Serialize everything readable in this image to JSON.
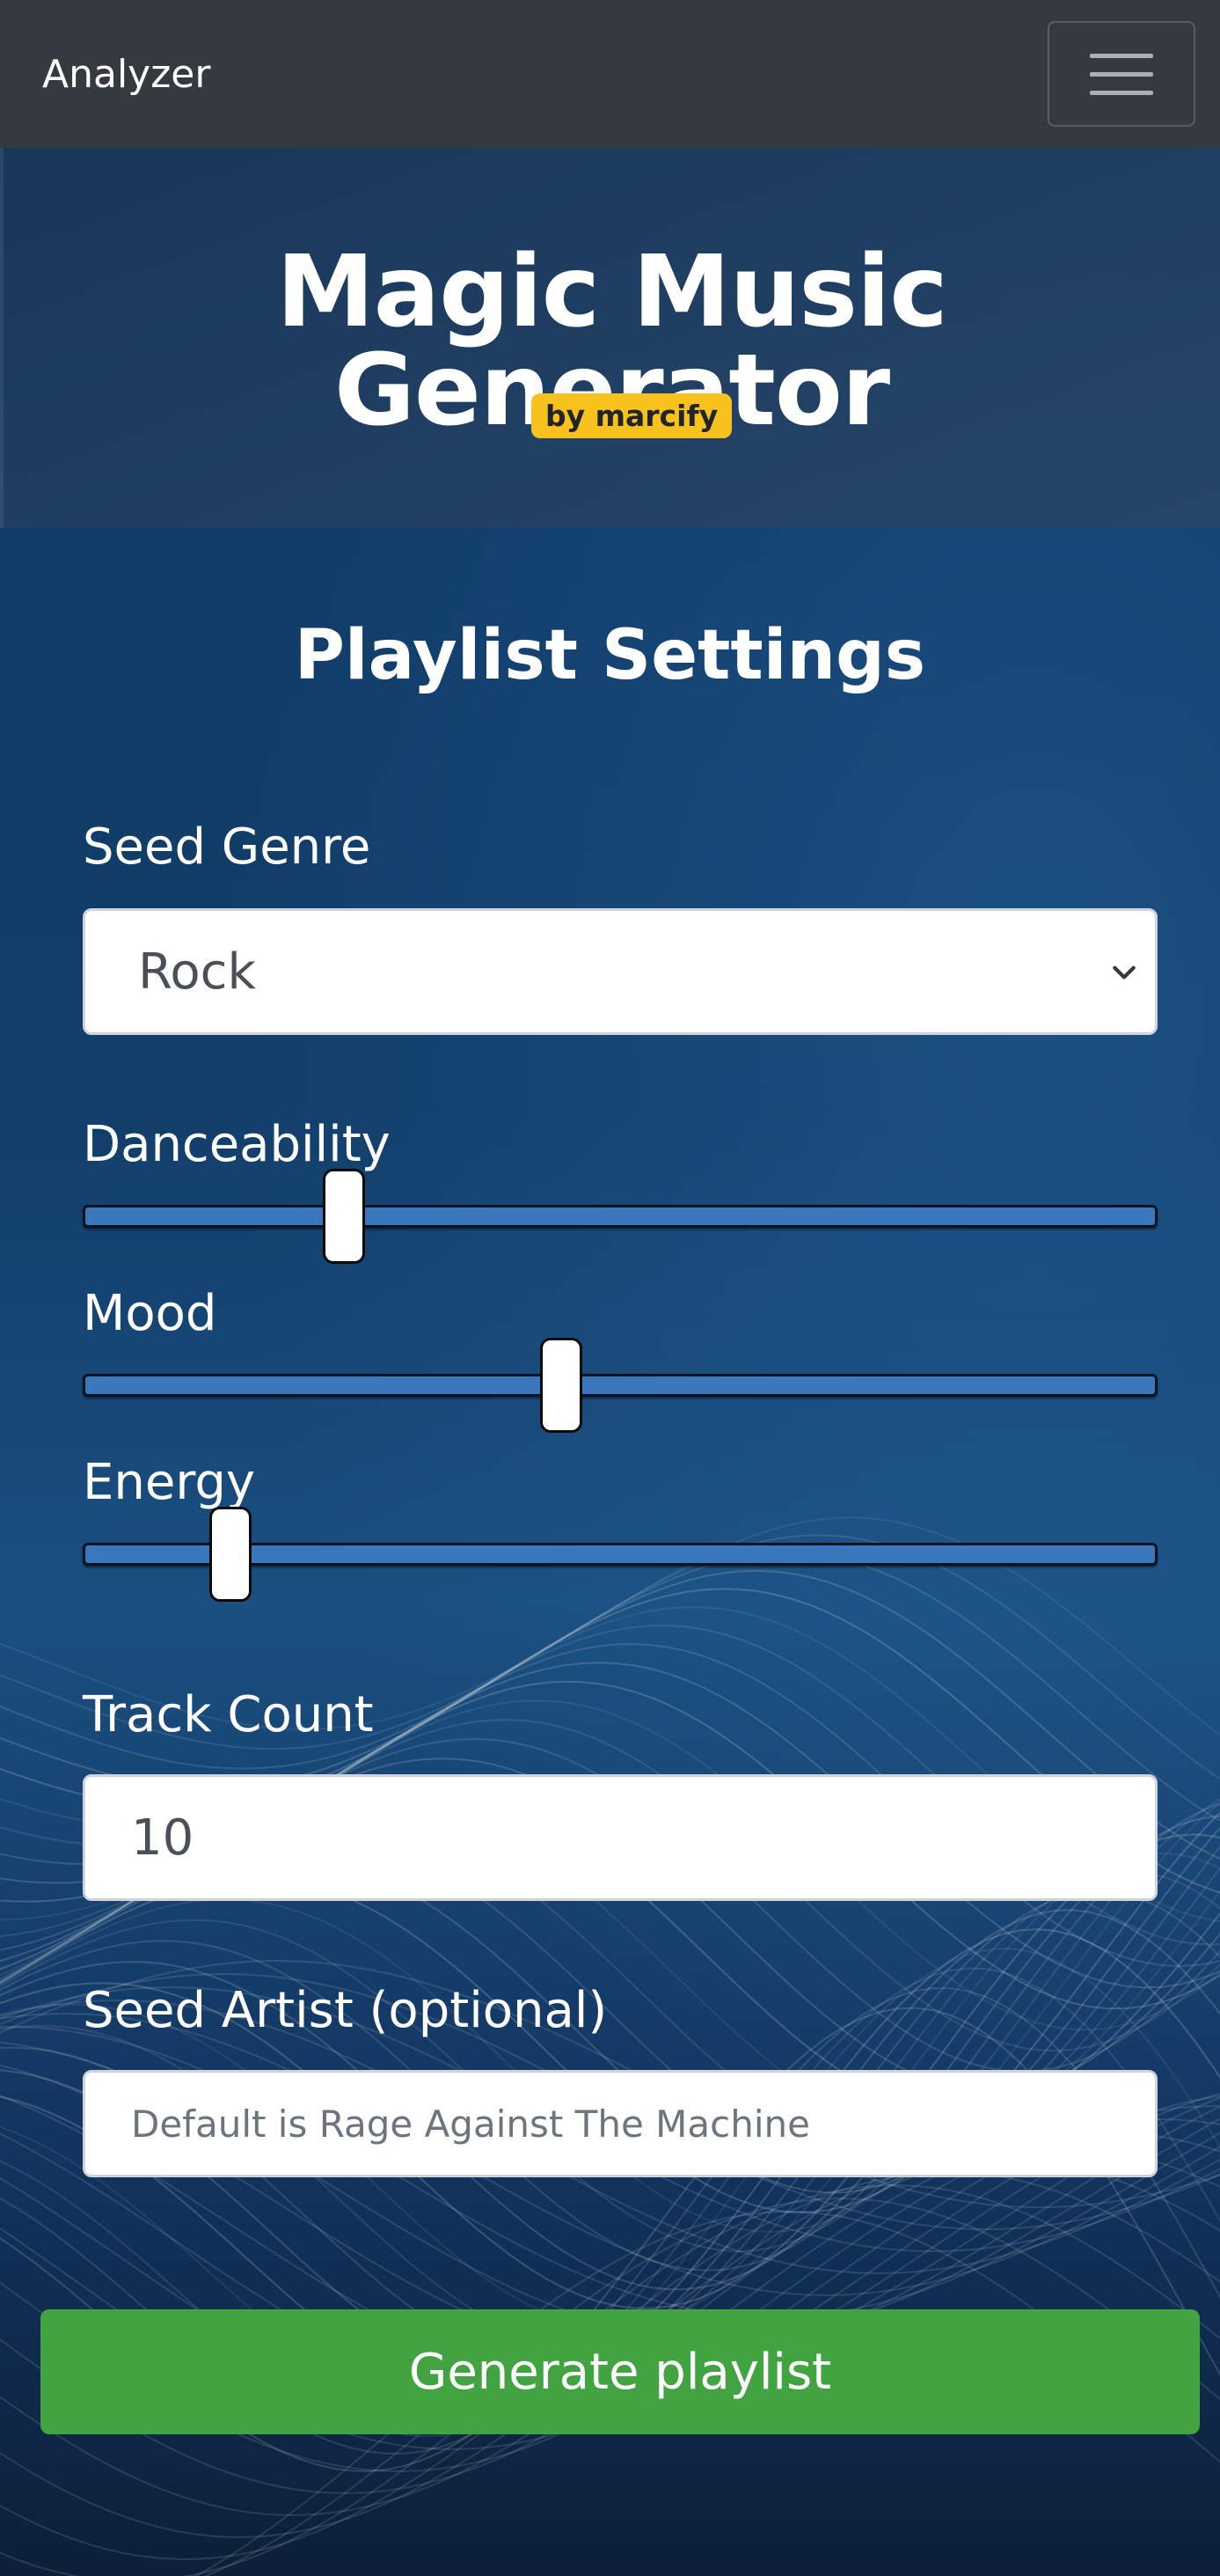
{
  "navbar": {
    "brand": "Analyzer",
    "menu_icon": "hamburger-icon"
  },
  "header": {
    "title": "Magic Music Generator",
    "badge": "by marcify",
    "badge_color": "#f7c21b"
  },
  "settings": {
    "title": "Playlist Settings",
    "seed_genre": {
      "label": "Seed Genre",
      "value": "Rock"
    },
    "danceability": {
      "label": "Danceability",
      "value_fraction": 0.23
    },
    "mood": {
      "label": "Mood",
      "value_fraction": 0.44
    },
    "energy": {
      "label": "Energy",
      "value_fraction": 0.12
    },
    "track_count": {
      "label": "Track Count",
      "value": "10"
    },
    "seed_artist": {
      "label": "Seed Artist (optional)",
      "placeholder": "Default is Rage Against The Machine"
    },
    "generate_button": "Generate playlist"
  },
  "colors": {
    "navbar": "#343a40",
    "button": "#41a441",
    "slider": "#3b77bd"
  }
}
